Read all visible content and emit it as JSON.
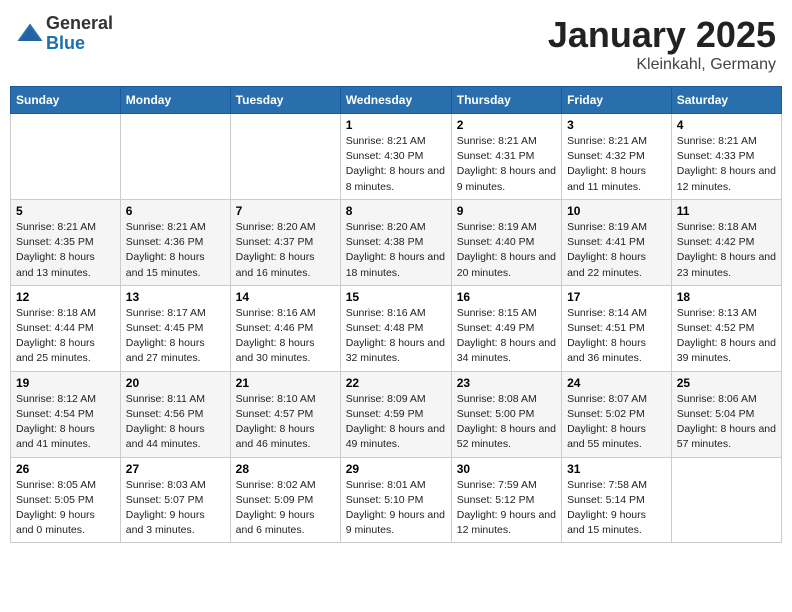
{
  "logo": {
    "general": "General",
    "blue": "Blue"
  },
  "title": "January 2025",
  "subtitle": "Kleinkahl, Germany",
  "weekdays": [
    "Sunday",
    "Monday",
    "Tuesday",
    "Wednesday",
    "Thursday",
    "Friday",
    "Saturday"
  ],
  "weeks": [
    [
      {
        "day": "",
        "sunrise": "",
        "sunset": "",
        "daylight": ""
      },
      {
        "day": "",
        "sunrise": "",
        "sunset": "",
        "daylight": ""
      },
      {
        "day": "",
        "sunrise": "",
        "sunset": "",
        "daylight": ""
      },
      {
        "day": "1",
        "sunrise": "Sunrise: 8:21 AM",
        "sunset": "Sunset: 4:30 PM",
        "daylight": "Daylight: 8 hours and 8 minutes."
      },
      {
        "day": "2",
        "sunrise": "Sunrise: 8:21 AM",
        "sunset": "Sunset: 4:31 PM",
        "daylight": "Daylight: 8 hours and 9 minutes."
      },
      {
        "day": "3",
        "sunrise": "Sunrise: 8:21 AM",
        "sunset": "Sunset: 4:32 PM",
        "daylight": "Daylight: 8 hours and 11 minutes."
      },
      {
        "day": "4",
        "sunrise": "Sunrise: 8:21 AM",
        "sunset": "Sunset: 4:33 PM",
        "daylight": "Daylight: 8 hours and 12 minutes."
      }
    ],
    [
      {
        "day": "5",
        "sunrise": "Sunrise: 8:21 AM",
        "sunset": "Sunset: 4:35 PM",
        "daylight": "Daylight: 8 hours and 13 minutes."
      },
      {
        "day": "6",
        "sunrise": "Sunrise: 8:21 AM",
        "sunset": "Sunset: 4:36 PM",
        "daylight": "Daylight: 8 hours and 15 minutes."
      },
      {
        "day": "7",
        "sunrise": "Sunrise: 8:20 AM",
        "sunset": "Sunset: 4:37 PM",
        "daylight": "Daylight: 8 hours and 16 minutes."
      },
      {
        "day": "8",
        "sunrise": "Sunrise: 8:20 AM",
        "sunset": "Sunset: 4:38 PM",
        "daylight": "Daylight: 8 hours and 18 minutes."
      },
      {
        "day": "9",
        "sunrise": "Sunrise: 8:19 AM",
        "sunset": "Sunset: 4:40 PM",
        "daylight": "Daylight: 8 hours and 20 minutes."
      },
      {
        "day": "10",
        "sunrise": "Sunrise: 8:19 AM",
        "sunset": "Sunset: 4:41 PM",
        "daylight": "Daylight: 8 hours and 22 minutes."
      },
      {
        "day": "11",
        "sunrise": "Sunrise: 8:18 AM",
        "sunset": "Sunset: 4:42 PM",
        "daylight": "Daylight: 8 hours and 23 minutes."
      }
    ],
    [
      {
        "day": "12",
        "sunrise": "Sunrise: 8:18 AM",
        "sunset": "Sunset: 4:44 PM",
        "daylight": "Daylight: 8 hours and 25 minutes."
      },
      {
        "day": "13",
        "sunrise": "Sunrise: 8:17 AM",
        "sunset": "Sunset: 4:45 PM",
        "daylight": "Daylight: 8 hours and 27 minutes."
      },
      {
        "day": "14",
        "sunrise": "Sunrise: 8:16 AM",
        "sunset": "Sunset: 4:46 PM",
        "daylight": "Daylight: 8 hours and 30 minutes."
      },
      {
        "day": "15",
        "sunrise": "Sunrise: 8:16 AM",
        "sunset": "Sunset: 4:48 PM",
        "daylight": "Daylight: 8 hours and 32 minutes."
      },
      {
        "day": "16",
        "sunrise": "Sunrise: 8:15 AM",
        "sunset": "Sunset: 4:49 PM",
        "daylight": "Daylight: 8 hours and 34 minutes."
      },
      {
        "day": "17",
        "sunrise": "Sunrise: 8:14 AM",
        "sunset": "Sunset: 4:51 PM",
        "daylight": "Daylight: 8 hours and 36 minutes."
      },
      {
        "day": "18",
        "sunrise": "Sunrise: 8:13 AM",
        "sunset": "Sunset: 4:52 PM",
        "daylight": "Daylight: 8 hours and 39 minutes."
      }
    ],
    [
      {
        "day": "19",
        "sunrise": "Sunrise: 8:12 AM",
        "sunset": "Sunset: 4:54 PM",
        "daylight": "Daylight: 8 hours and 41 minutes."
      },
      {
        "day": "20",
        "sunrise": "Sunrise: 8:11 AM",
        "sunset": "Sunset: 4:56 PM",
        "daylight": "Daylight: 8 hours and 44 minutes."
      },
      {
        "day": "21",
        "sunrise": "Sunrise: 8:10 AM",
        "sunset": "Sunset: 4:57 PM",
        "daylight": "Daylight: 8 hours and 46 minutes."
      },
      {
        "day": "22",
        "sunrise": "Sunrise: 8:09 AM",
        "sunset": "Sunset: 4:59 PM",
        "daylight": "Daylight: 8 hours and 49 minutes."
      },
      {
        "day": "23",
        "sunrise": "Sunrise: 8:08 AM",
        "sunset": "Sunset: 5:00 PM",
        "daylight": "Daylight: 8 hours and 52 minutes."
      },
      {
        "day": "24",
        "sunrise": "Sunrise: 8:07 AM",
        "sunset": "Sunset: 5:02 PM",
        "daylight": "Daylight: 8 hours and 55 minutes."
      },
      {
        "day": "25",
        "sunrise": "Sunrise: 8:06 AM",
        "sunset": "Sunset: 5:04 PM",
        "daylight": "Daylight: 8 hours and 57 minutes."
      }
    ],
    [
      {
        "day": "26",
        "sunrise": "Sunrise: 8:05 AM",
        "sunset": "Sunset: 5:05 PM",
        "daylight": "Daylight: 9 hours and 0 minutes."
      },
      {
        "day": "27",
        "sunrise": "Sunrise: 8:03 AM",
        "sunset": "Sunset: 5:07 PM",
        "daylight": "Daylight: 9 hours and 3 minutes."
      },
      {
        "day": "28",
        "sunrise": "Sunrise: 8:02 AM",
        "sunset": "Sunset: 5:09 PM",
        "daylight": "Daylight: 9 hours and 6 minutes."
      },
      {
        "day": "29",
        "sunrise": "Sunrise: 8:01 AM",
        "sunset": "Sunset: 5:10 PM",
        "daylight": "Daylight: 9 hours and 9 minutes."
      },
      {
        "day": "30",
        "sunrise": "Sunrise: 7:59 AM",
        "sunset": "Sunset: 5:12 PM",
        "daylight": "Daylight: 9 hours and 12 minutes."
      },
      {
        "day": "31",
        "sunrise": "Sunrise: 7:58 AM",
        "sunset": "Sunset: 5:14 PM",
        "daylight": "Daylight: 9 hours and 15 minutes."
      },
      {
        "day": "",
        "sunrise": "",
        "sunset": "",
        "daylight": ""
      }
    ]
  ]
}
